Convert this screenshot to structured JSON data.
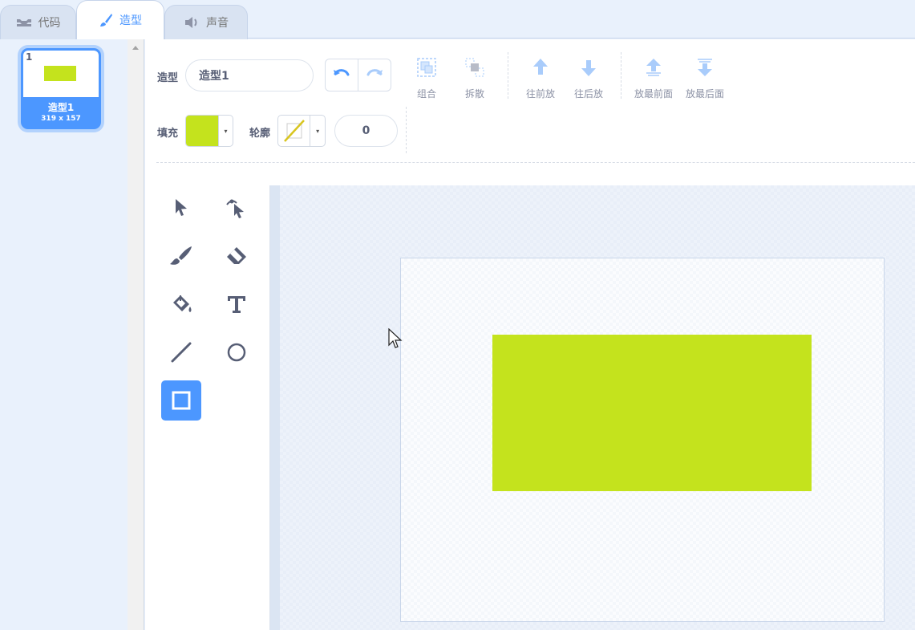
{
  "tabs": [
    {
      "label": "代码",
      "icon": "code-icon"
    },
    {
      "label": "造型",
      "icon": "paintbrush-icon"
    },
    {
      "label": "声音",
      "icon": "speaker-icon"
    }
  ],
  "costume_list": {
    "items": [
      {
        "number": "1",
        "name": "造型1",
        "size": "319 x 157",
        "thumb_color": "#c4e31d"
      }
    ]
  },
  "toolbar": {
    "costume_label": "造型",
    "costume_name": "造型1",
    "undo_icon": "undo-icon",
    "redo_icon": "redo-icon",
    "group_label": "组合",
    "ungroup_label": "拆散",
    "forward_label": "往前放",
    "backward_label": "往后放",
    "front_label": "放最前面",
    "back_label": "放最后面",
    "fill_label": "填充",
    "fill_color": "#c4e31d",
    "outline_label": "轮廓",
    "outline_width": "0"
  },
  "tools": [
    {
      "name": "select-tool",
      "icon": "arrow-pointer-icon"
    },
    {
      "name": "reshape-tool",
      "icon": "reshape-icon"
    },
    {
      "name": "brush-tool",
      "icon": "brush-icon"
    },
    {
      "name": "eraser-tool",
      "icon": "eraser-icon"
    },
    {
      "name": "fill-tool",
      "icon": "paint-bucket-icon"
    },
    {
      "name": "text-tool",
      "icon": "text-icon"
    },
    {
      "name": "line-tool",
      "icon": "line-icon"
    },
    {
      "name": "circle-tool",
      "icon": "circle-icon"
    },
    {
      "name": "rectangle-tool",
      "icon": "rectangle-icon",
      "active": true
    }
  ],
  "colors": {
    "accent": "#4c97ff",
    "shape_fill": "#c4e31d",
    "text": "#575e75"
  }
}
